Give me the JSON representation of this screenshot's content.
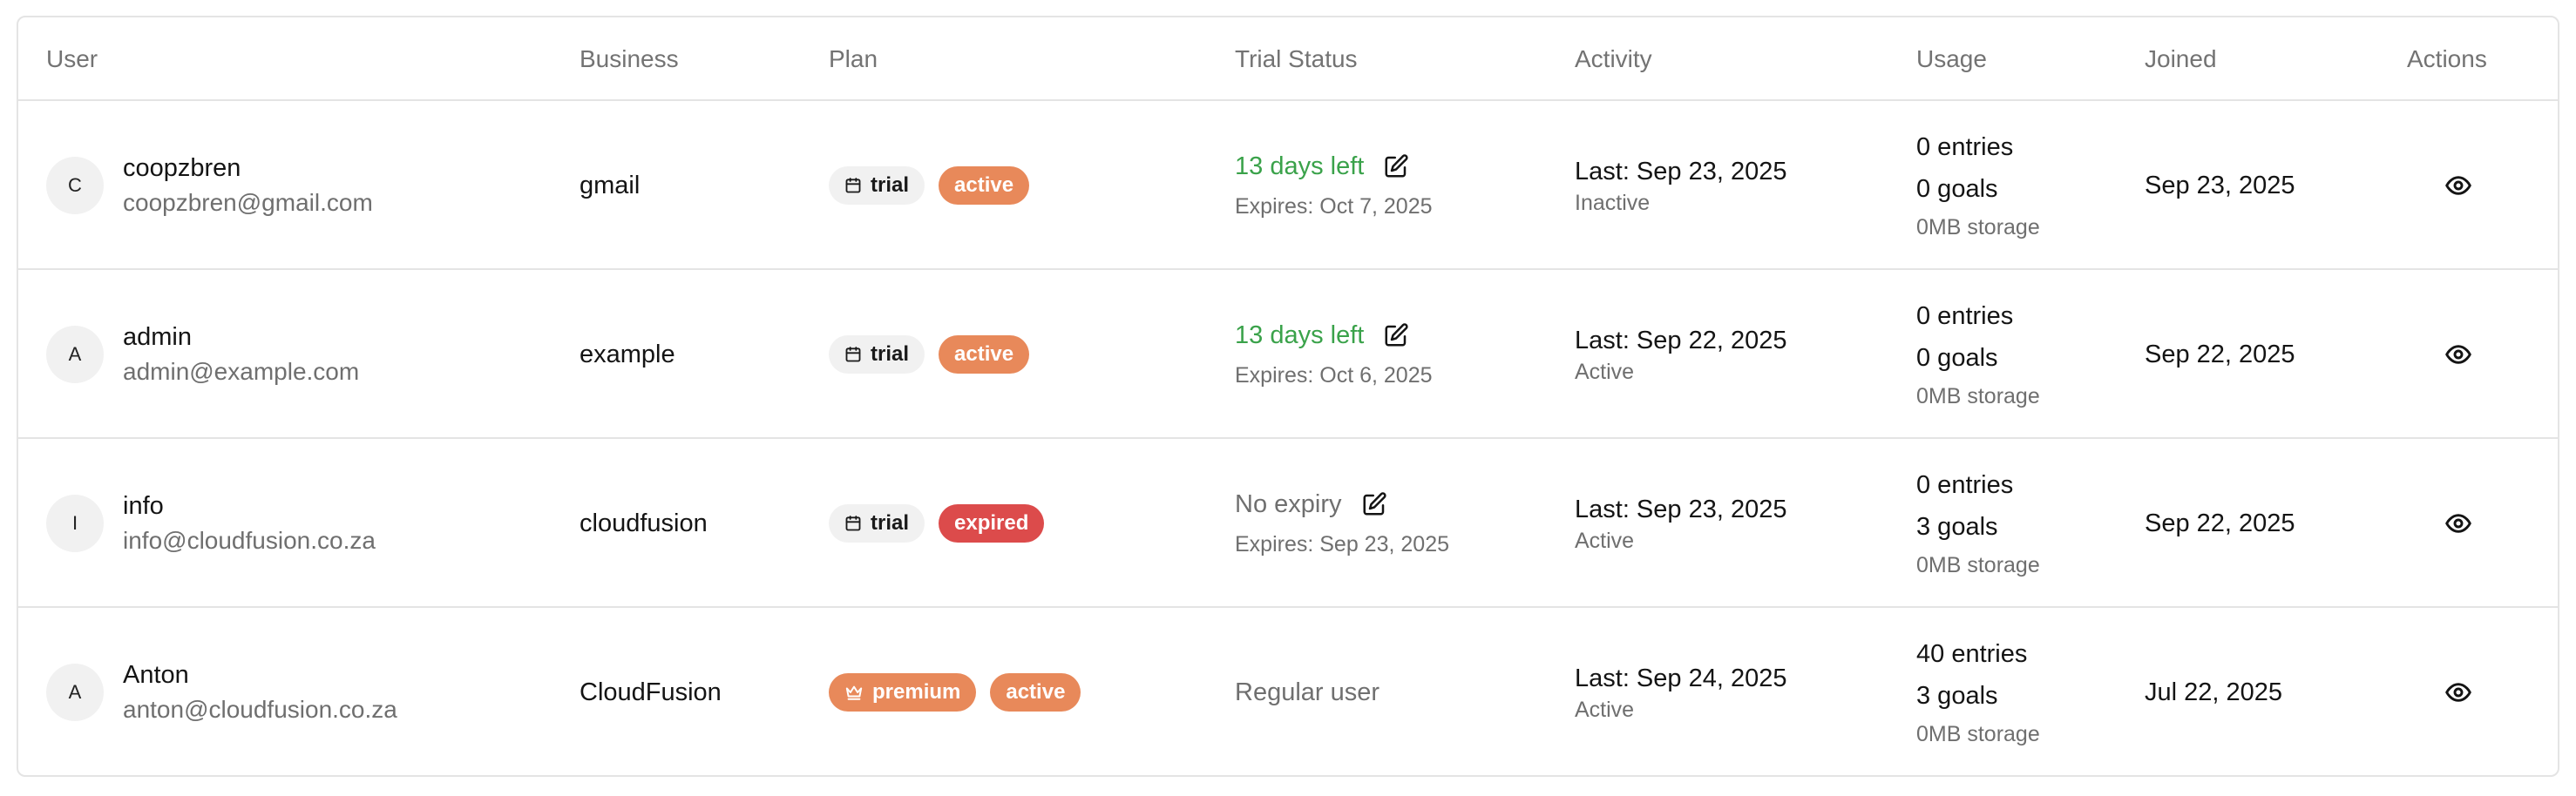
{
  "columns": {
    "user": "User",
    "business": "Business",
    "plan": "Plan",
    "trial_status": "Trial Status",
    "activity": "Activity",
    "usage": "Usage",
    "joined": "Joined",
    "actions": "Actions"
  },
  "rows": [
    {
      "initial": "C",
      "name": "coopzbren",
      "email": "coopzbren@gmail.com",
      "business": "gmail",
      "plan": "trial",
      "plan_icon": "calendar-icon",
      "status": "active",
      "trial_main": "13 days left",
      "trial_expires": "Expires: Oct 7, 2025",
      "activity_last": "Last: Sep 23, 2025",
      "activity_state": "Inactive",
      "usage_entries": "0 entries",
      "usage_goals": "0 goals",
      "usage_storage": "0MB storage",
      "joined": "Sep 23, 2025"
    },
    {
      "initial": "A",
      "name": "admin",
      "email": "admin@example.com",
      "business": "example",
      "plan": "trial",
      "plan_icon": "calendar-icon",
      "status": "active",
      "trial_main": "13 days left",
      "trial_expires": "Expires: Oct 6, 2025",
      "activity_last": "Last: Sep 22, 2025",
      "activity_state": "Active",
      "usage_entries": "0 entries",
      "usage_goals": "0 goals",
      "usage_storage": "0MB storage",
      "joined": "Sep 22, 2025"
    },
    {
      "initial": "I",
      "name": "info",
      "email": "info@cloudfusion.co.za",
      "business": "cloudfusion",
      "plan": "trial",
      "plan_icon": "calendar-icon",
      "status": "expired",
      "trial_main": "No expiry",
      "trial_expires": "Expires: Sep 23, 2025",
      "activity_last": "Last: Sep 23, 2025",
      "activity_state": "Active",
      "usage_entries": "0 entries",
      "usage_goals": "3 goals",
      "usage_storage": "0MB storage",
      "joined": "Sep 22, 2025"
    },
    {
      "initial": "A",
      "name": "Anton",
      "email": "anton@cloudfusion.co.za",
      "business": "CloudFusion",
      "plan": "premium",
      "plan_icon": "crown-icon",
      "status": "active",
      "trial_main": "Regular user",
      "activity_last": "Last: Sep 24, 2025",
      "activity_state": "Active",
      "usage_entries": "40 entries",
      "usage_goals": "3 goals",
      "usage_storage": "0MB storage",
      "joined": "Jul 22, 2025"
    }
  ],
  "colors": {
    "accent_orange": "#e8895a",
    "expired_red": "#dc4b4b",
    "days_left_green": "#3aa24a",
    "muted_text": "#6f6f6f",
    "border": "#e4e4e4"
  },
  "icons": {
    "edit": "edit-icon",
    "view": "eye-icon",
    "trial": "calendar-icon",
    "premium": "crown-icon"
  }
}
